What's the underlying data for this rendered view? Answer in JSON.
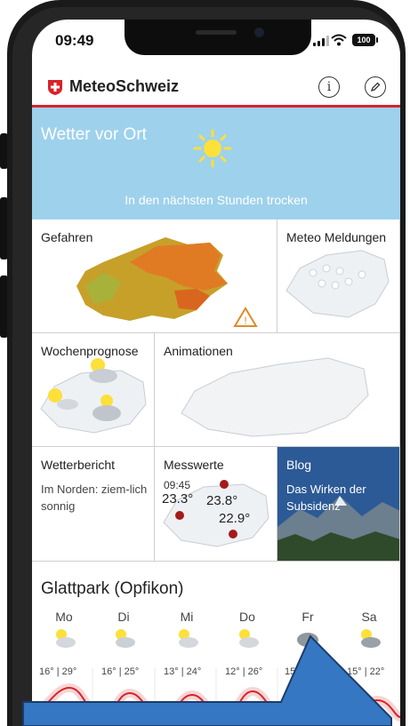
{
  "status": {
    "time": "09:49",
    "battery": "100"
  },
  "app": {
    "brand": "MeteoSchweiz",
    "info_icon": "info-icon",
    "edit_icon": "pencil-icon",
    "brand_color": "#d8232a"
  },
  "hero": {
    "title": "Wetter vor Ort",
    "subtitle": "In den nächsten Stunden trocken"
  },
  "tiles": {
    "gefahren": "Gefahren",
    "meldungen": "Meteo Meldungen",
    "wochen": "Wochenprognose",
    "animationen": "Animationen",
    "bericht": {
      "title": "Wetterbericht",
      "text": "Im Norden: ziem-lich sonnig"
    },
    "messwerte": {
      "title": "Messwerte",
      "time": "09:45",
      "v1": "23.3°",
      "v2": "23.8°",
      "v3": "22.9°"
    },
    "blog": {
      "title": "Blog",
      "text": "Das Wirken der Subsidenz"
    }
  },
  "forecast": {
    "location": "Glattpark (Opfikon)",
    "days": [
      {
        "name": "Mo",
        "temp": "16° | 29°"
      },
      {
        "name": "Di",
        "temp": "16° | 25°"
      },
      {
        "name": "Mi",
        "temp": "13° | 24°"
      },
      {
        "name": "Do",
        "temp": "12° | 26°"
      },
      {
        "name": "Fr",
        "temp": "15° | 22°"
      },
      {
        "name": "Sa",
        "temp": "15° | 22°"
      }
    ]
  }
}
